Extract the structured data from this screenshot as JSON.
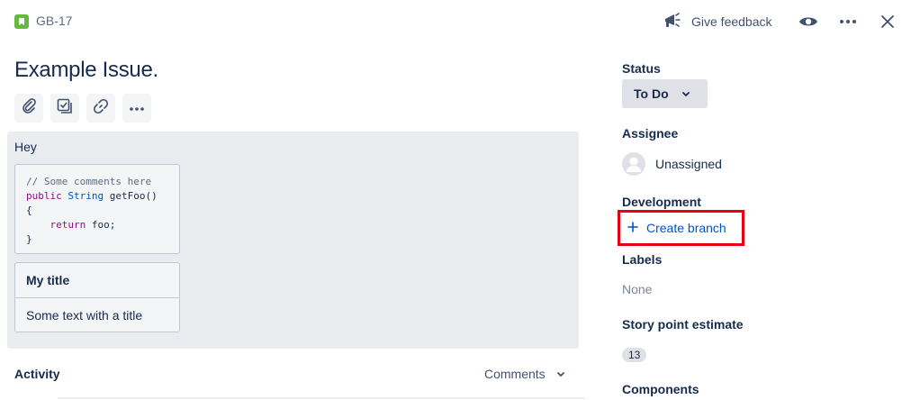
{
  "header": {
    "issue_key": "GB-17",
    "feedback_label": "Give feedback",
    "icons": [
      "story-icon",
      "megaphone-icon",
      "eye-icon",
      "more-icon",
      "close-icon"
    ]
  },
  "issue": {
    "title": "Example Issue.",
    "toolbar_icons": [
      "attachment-icon",
      "subtask-icon",
      "link-icon",
      "more-icon"
    ]
  },
  "description": {
    "text": "Hey",
    "code": {
      "comment": "// Some comments here",
      "kw_public": "public",
      "type_string": "String",
      "signature_rest": "getFoo()",
      "open_brace": "{",
      "kw_return": "return",
      "return_rest": "foo;",
      "close_brace": "}"
    },
    "panel": {
      "title": "My title",
      "body": "Some text with a title"
    }
  },
  "activity": {
    "label": "Activity",
    "filter_label": "Comments"
  },
  "fields": {
    "status": {
      "label": "Status",
      "value": "To Do"
    },
    "assignee": {
      "label": "Assignee",
      "value": "Unassigned"
    },
    "development": {
      "label": "Development",
      "action": "Create branch"
    },
    "labels": {
      "label": "Labels",
      "value": "None"
    },
    "story_points": {
      "label": "Story point estimate",
      "value": "13"
    },
    "components": {
      "label": "Components"
    }
  },
  "colors": {
    "accent": "#0052cc",
    "highlight": "#e60012",
    "story_green": "#63ba3c"
  }
}
